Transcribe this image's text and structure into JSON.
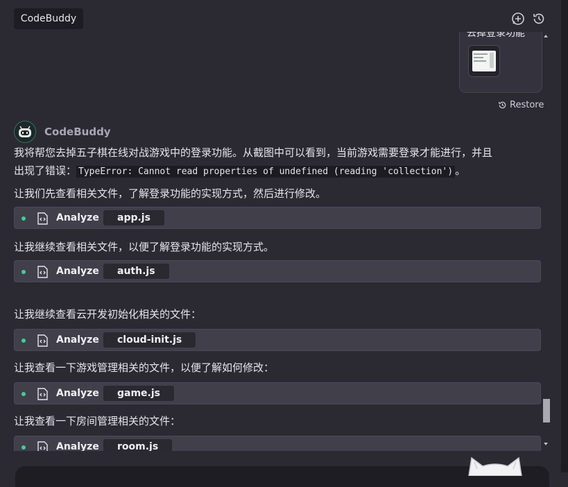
{
  "header": {
    "title": "CodeBuddy",
    "new_chat_icon": "new-chat-icon",
    "history_icon": "history-icon"
  },
  "user_message": {
    "text": "去掉登录功能",
    "attachment": "screenshot-thumbnail"
  },
  "restore_label": "Restore",
  "agent": {
    "name": "CodeBuddy"
  },
  "messages": {
    "p1_line1": "我将帮您去掉五子棋在线对战游戏中的登录功能。从截图中可以看到，当前游戏需要登录才能进行，并且",
    "p1_line2_prefix": "出现了错误：",
    "p1_code": "TypeError: Cannot read properties of undefined (reading 'collection')",
    "p1_line2_suffix": "。",
    "p2": "让我们先查看相关文件，了解登录功能的实现方式，然后进行修改。",
    "p3": "让我继续查看相关文件，以便了解登录功能的实现方式。",
    "p4": "让我继续查看云开发初始化相关的文件：",
    "p5": "让我查看一下游戏管理相关的文件，以便了解如何修改：",
    "p6": "让我查看一下房间管理相关的文件："
  },
  "steps": [
    {
      "action": "Analyze",
      "file": "app.js"
    },
    {
      "action": "Analyze",
      "file": "auth.js"
    },
    {
      "action": "Analyze",
      "file": "cloud-init.js"
    },
    {
      "action": "Analyze",
      "file": "game.js"
    },
    {
      "action": "Analyze",
      "file": "room.js"
    }
  ],
  "colors": {
    "background": "#2b2a33",
    "step_background": "#413f4a",
    "accent_dot": "#43cc9f"
  }
}
